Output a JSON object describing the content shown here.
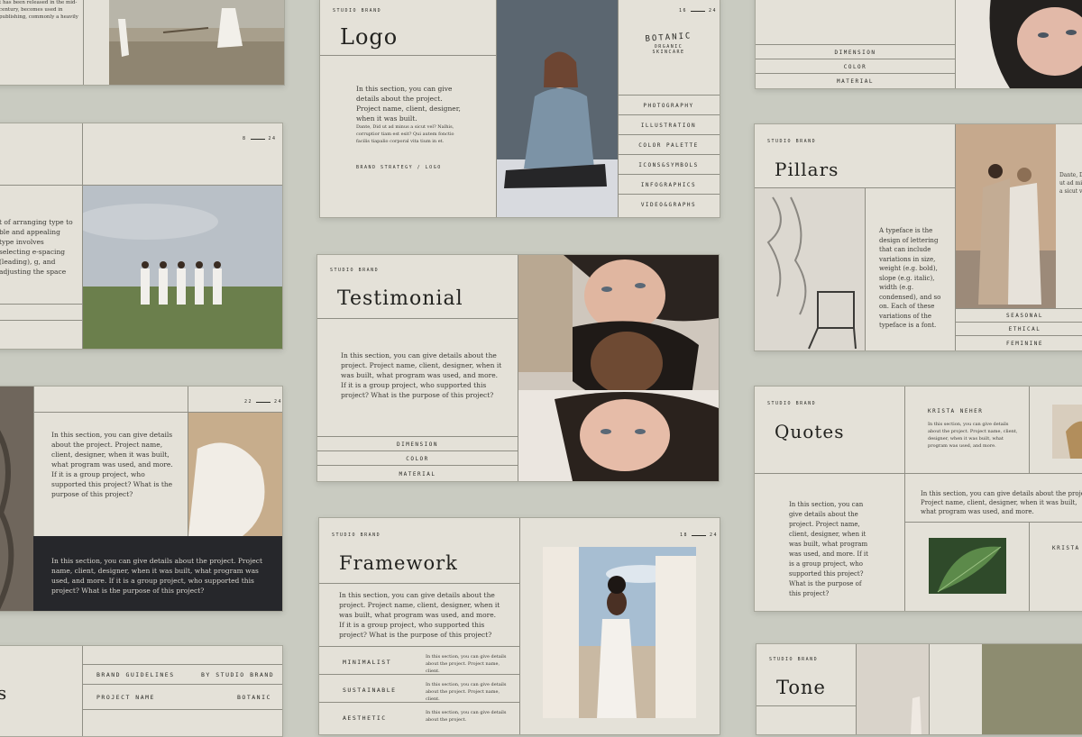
{
  "brand": {
    "studio": "STUDIO BRAND",
    "botanic": "BOTANIC",
    "organic": "ORGANIC",
    "skincare": "SKINCARE"
  },
  "logo_slide": {
    "title": "Logo",
    "page": "16",
    "total": "24",
    "body": "In this section, you can give details about the project. Project name, client, designer, when it was built.",
    "body2": "Dante, Did ut ad minus a sicut vel? Nalhis, corruptior tiam est esit? Qui autem fonctio facilis tiapalio corporal vita tium in et.",
    "footer": "BRAND STRATEGY / LOGO",
    "menu": [
      "PHOTOGRAPHY",
      "ILLUSTRATION",
      "COLOR PALETTE",
      "ICONS&SYMBOLS",
      "INFOGRAPHICS",
      "VIDEO&GRAPHS"
    ]
  },
  "testimonial_slide": {
    "title": "Testimonial",
    "body": "In this section, you can give details about the project. Project name, client, designer, when it was built, what program was used, and more. If it is a group project, who supported this project? What is the purpose of this project?",
    "menu": [
      "DIMENSION",
      "COLOR",
      "MATERIAL"
    ]
  },
  "framework_slide": {
    "title": "Framework",
    "page": "18",
    "total": "24",
    "body": "In this section, you can give details about the project. Project name, client, designer, when it was built, what program was used, and more. If it is a group project, who supported this project? What is the purpose of this project?",
    "rows": [
      {
        "label": "MINIMALIST",
        "text": "In this section, you can give details about the project. Project name, client."
      },
      {
        "label": "SUSTAINABLE",
        "text": "In this section, you can give details about the project. Project name, client."
      },
      {
        "label": "AESTHETIC",
        "text": "In this section, you can give details about the project."
      }
    ]
  },
  "pillars_slide": {
    "title": "Pillars",
    "body": "A typeface is the design of lettering that can include variations in size, weight (e.g. bold), slope (e.g. italic), width (e.g. condensed), and so on. Each of these variations of the typeface is a font.",
    "menu": [
      "SEASONAL",
      "ETHICAL",
      "FEMININE"
    ],
    "cut": "Dante, Did ut ad minus a sicut vel"
  },
  "quotes_slide": {
    "title": "Quotes",
    "name": "KRISTA NEHER",
    "name2": "KRISTA",
    "small": "In this section, you can give details about the project. Project name, client, designer, when it was built, what program was used, and more.",
    "body": "In this section, you can give details about the project. Project name, client, designer, when it was built, what program was used, and more. If it is a group project, who supported this project? What is the purpose of this project?",
    "wide": "In this section, you can give details about the project. Project name, client, designer, when it was built, what program was used, and more."
  },
  "top_right_slide": {
    "menu": [
      "DIMENSION",
      "COLOR",
      "MATERIAL"
    ]
  },
  "tone_slide": {
    "title": "Tone"
  },
  "left_mid_slide": {
    "page": "8",
    "total": "24",
    "body": "t of arranging type to ble and appealing type involves selecting e-spacing (leading), g, and adjusting the space"
  },
  "left_bottom_slide": {
    "page": "22",
    "total": "24",
    "body": "In this section, you can give details about the project. Project name, client, designer, when it was built, what program was used, and more. If it is a group project, who supported this project? What is the purpose of this project?",
    "dark": "In this section, you can give details about the project. Project name, client, designer, when it was built, what program was used, and more. If it is a group project, who supported this project? What is the purpose of this project?"
  },
  "brand_guidelines_slide": {
    "left": "BRAND GUIDELINES",
    "right": "BY STUDIO BRAND",
    "name_label": "PROJECT NAME",
    "name_value": "BOTANIC",
    "cut_title": "s"
  },
  "top_left_slide": {
    "body": "t has been released in the mid-century, becomes used in publishing, commonly a heavily"
  },
  "colors": {
    "background": "#c9cbc1",
    "slide": "#e4e1d8",
    "dark_panel": "#26272b",
    "line": "#8f8e84"
  }
}
